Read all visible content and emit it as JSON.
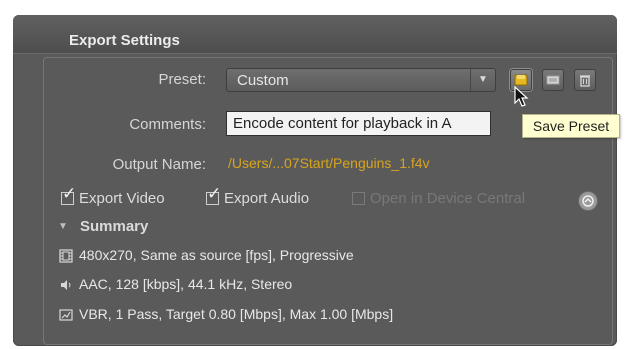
{
  "panel": {
    "title": "Export Settings"
  },
  "preset": {
    "label": "Preset:",
    "value": "Custom",
    "tooltip": "Save Preset"
  },
  "comments": {
    "label": "Comments:",
    "value": "Encode content for playback in A"
  },
  "output": {
    "label": "Output Name:",
    "value": "/Users/...07Start/Penguins_1.f4v"
  },
  "options": {
    "export_video": "Export Video",
    "export_audio": "Export Audio",
    "device_central": "Open in Device Central"
  },
  "checked": {
    "export_video": true,
    "export_audio": true,
    "device_central": false
  },
  "summary": {
    "title": "Summary",
    "video": "480x270, Same as source [fps], Progressive",
    "audio": "AAC, 128 [kbps], 44.1 kHz, Stereo",
    "bitrate": "VBR, 1 Pass, Target 0.80 [Mbps], Max 1.00 [Mbps]"
  },
  "colors": {
    "panel": "#5a5a5a",
    "output_path": "#d7a51d",
    "tooltip": "#fffed0"
  },
  "icons": [
    "save-preset-icon",
    "import-preset-icon",
    "delete-preset-icon",
    "help-icon",
    "video-icon",
    "audio-icon",
    "bitrate-icon"
  ]
}
